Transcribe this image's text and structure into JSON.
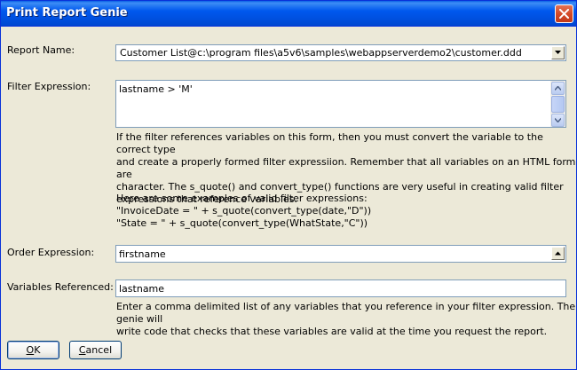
{
  "window": {
    "title": "Print Report Genie"
  },
  "report_name": {
    "label": "Report Name:",
    "value": "Customer List@c:\\program files\\a5v6\\samples\\webappserverdemo2\\customer.ddd"
  },
  "filter": {
    "label": "Filter Expression:",
    "value": "lastname > 'M'",
    "help_lines": [
      "If the filter references variables on this form, then you must convert the variable to the correct type",
      "and create a properly formed filter expressiion. Remember that all variables on an HTML form are",
      "character. The s_quote() and convert_type() functions are very useful in creating valid filter",
      "expressions that reference variables."
    ],
    "examples_intro": "Here are some examples of valid filter expressions:",
    "example_1": "\"InvoiceDate = \" + s_quote(convert_type(date,\"D\"))",
    "example_2": "\"State = \" + s_quote(convert_type(WhatState,\"C\"))"
  },
  "order": {
    "label": "Order Expression:",
    "value": "firstname"
  },
  "variables": {
    "label": "Variables Referenced:",
    "value": "lastname",
    "help_lines": [
      "Enter a comma delimited list of any variables that you reference in your filter expression. The genie will",
      "write code that checks that these variables are valid at the time you request the report."
    ]
  },
  "buttons": {
    "ok_mnemonic": "O",
    "ok_rest": "K",
    "cancel_mnemonic": "C",
    "cancel_rest": "ancel"
  },
  "colors": {
    "titlebar": "#0058ee",
    "dialog_bg": "#ece9d8",
    "field_border": "#7f9db9",
    "close_button": "#d44a27"
  },
  "icons": {
    "close": "close-icon",
    "dropdown": "chevron-down-icon",
    "scroll_up": "arrow-up-icon",
    "scroll_down": "arrow-down-icon"
  }
}
